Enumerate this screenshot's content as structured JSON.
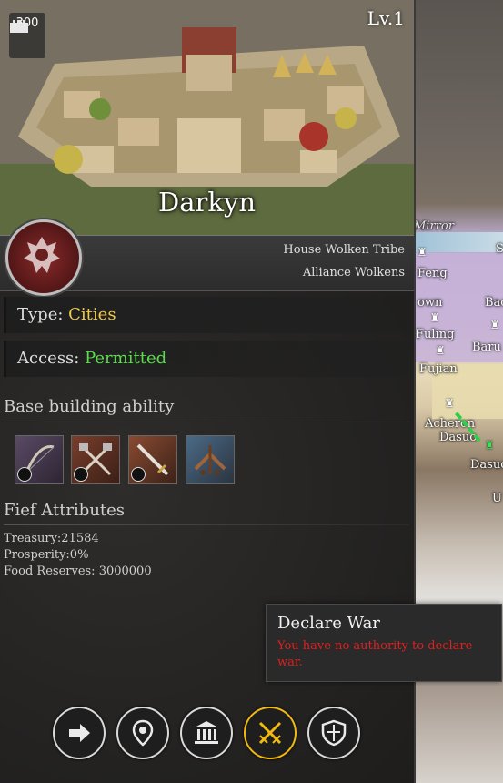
{
  "city": {
    "level": "Lv.1",
    "population": "300",
    "name": "Darkyn",
    "house": "House Wolken Tribe",
    "alliance": "Alliance Wolkens"
  },
  "info": {
    "type_label": "Type:",
    "type_value": "Cities",
    "access_label": "Access:",
    "access_value": "Permitted"
  },
  "base_building": {
    "title": "Base building ability",
    "items": [
      {
        "icon": "bow-icon",
        "locked": true
      },
      {
        "icon": "crossed-axes-icon",
        "locked": true
      },
      {
        "icon": "sword-icon",
        "locked": true
      },
      {
        "icon": "ballista-icon",
        "locked": false
      }
    ]
  },
  "fief": {
    "title": "Fief Attributes",
    "treasury": "Treasury:21584",
    "prosperity": "Prosperity:0%",
    "food": "Food Reserves: 3000000"
  },
  "tooltip": {
    "title": "Declare War",
    "message": "You have no authority to declare war."
  },
  "actions": [
    {
      "name": "move-button",
      "icon": "arrow-right-icon"
    },
    {
      "name": "locate-button",
      "icon": "map-pin-icon"
    },
    {
      "name": "building-button",
      "icon": "bank-icon"
    },
    {
      "name": "declare-war-button",
      "icon": "crossed-swords-icon",
      "active": true
    },
    {
      "name": "defense-button",
      "icon": "shield-icon"
    }
  ],
  "map_labels": {
    "mirror": "Mirror",
    "feng": "Feng",
    "fuling": "Fuling",
    "fujian": "Fujian",
    "achem": "Acheron",
    "dasuo": "Dasuo",
    "dasuo2": "Dasuo",
    "bar": "Baru",
    "s": "S",
    "ba": "Bac",
    "u": "U",
    "own": "own"
  },
  "colors": {
    "accent_gold": "#f2b90f",
    "type_value": "#f2c94c",
    "access_value": "#5bdc4c",
    "error_red": "#e0201c"
  }
}
